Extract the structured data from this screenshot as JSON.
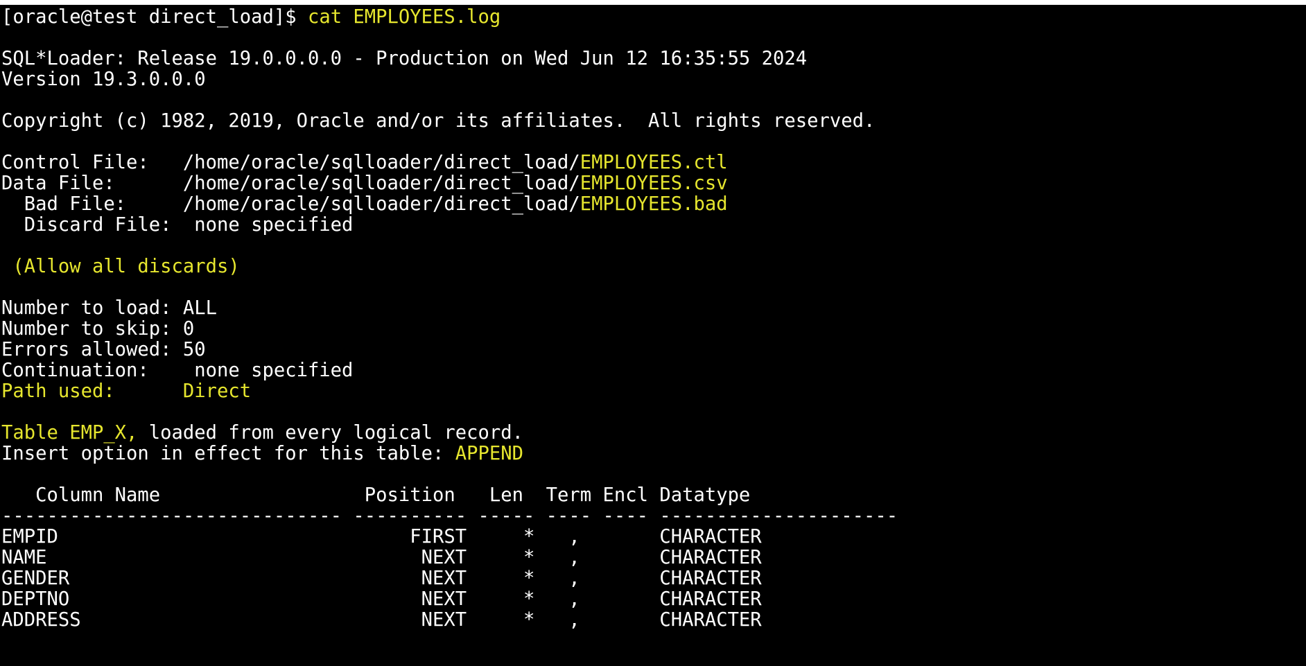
{
  "terminal": {
    "colors": {
      "background": "#000000",
      "text": "#ffffff",
      "highlight": "#e6e62e"
    },
    "lines": [
      [
        {
          "t": "[oracle@test direct_load]$ ",
          "c": "w"
        },
        {
          "t": "cat EMPLOYEES.log",
          "c": "y"
        }
      ],
      [],
      [
        {
          "t": "SQL*Loader: Release 19.0.0.0.0 - Production on Wed Jun 12 16:35:55 2024",
          "c": "w"
        }
      ],
      [
        {
          "t": "Version 19.3.0.0.0",
          "c": "w"
        }
      ],
      [],
      [
        {
          "t": "Copyright (c) 1982, 2019, Oracle and/or its affiliates.  All rights reserved.",
          "c": "w"
        }
      ],
      [],
      [
        {
          "t": "Control File:   /home/oracle/sqlloader/direct_load/",
          "c": "w"
        },
        {
          "t": "EMPLOYEES.ctl",
          "c": "y"
        }
      ],
      [
        {
          "t": "Data File:      /home/oracle/sqlloader/direct_load/",
          "c": "w"
        },
        {
          "t": "EMPLOYEES.csv",
          "c": "y"
        }
      ],
      [
        {
          "t": "  Bad File:     /home/oracle/sqlloader/direct_load/",
          "c": "w"
        },
        {
          "t": "EMPLOYEES.bad",
          "c": "y"
        }
      ],
      [
        {
          "t": "  Discard File:  none specified",
          "c": "w"
        }
      ],
      [],
      [
        {
          "t": " (Allow all discards)",
          "c": "y"
        }
      ],
      [],
      [
        {
          "t": "Number to load: ALL",
          "c": "w"
        }
      ],
      [
        {
          "t": "Number to skip: 0",
          "c": "w"
        }
      ],
      [
        {
          "t": "Errors allowed: 50",
          "c": "w"
        }
      ],
      [
        {
          "t": "Continuation:    none specified",
          "c": "w"
        }
      ],
      [
        {
          "t": "Path used:      Direct",
          "c": "y"
        }
      ],
      [],
      [
        {
          "t": "Table EMP_X,",
          "c": "y"
        },
        {
          "t": " loaded from every logical record.",
          "c": "w"
        }
      ],
      [
        {
          "t": "Insert option in effect for this table: ",
          "c": "w"
        },
        {
          "t": "APPEND",
          "c": "y"
        }
      ],
      [],
      [
        {
          "t": "   Column Name                  Position   Len  Term Encl Datatype",
          "c": "w"
        }
      ],
      [
        {
          "t": "------------------------------ ---------- ----- ---- ---- ---------------------",
          "c": "w"
        }
      ],
      [
        {
          "t": "EMPID                               FIRST     *   ,       CHARACTER",
          "c": "w"
        }
      ],
      [
        {
          "t": "NAME                                 NEXT     *   ,       CHARACTER",
          "c": "w"
        }
      ],
      [
        {
          "t": "GENDER                               NEXT     *   ,       CHARACTER",
          "c": "w"
        }
      ],
      [
        {
          "t": "DEPTNO                               NEXT     *   ,       CHARACTER",
          "c": "w"
        }
      ],
      [
        {
          "t": "ADDRESS                              NEXT     *   ,       CHARACTER",
          "c": "w"
        }
      ]
    ]
  }
}
